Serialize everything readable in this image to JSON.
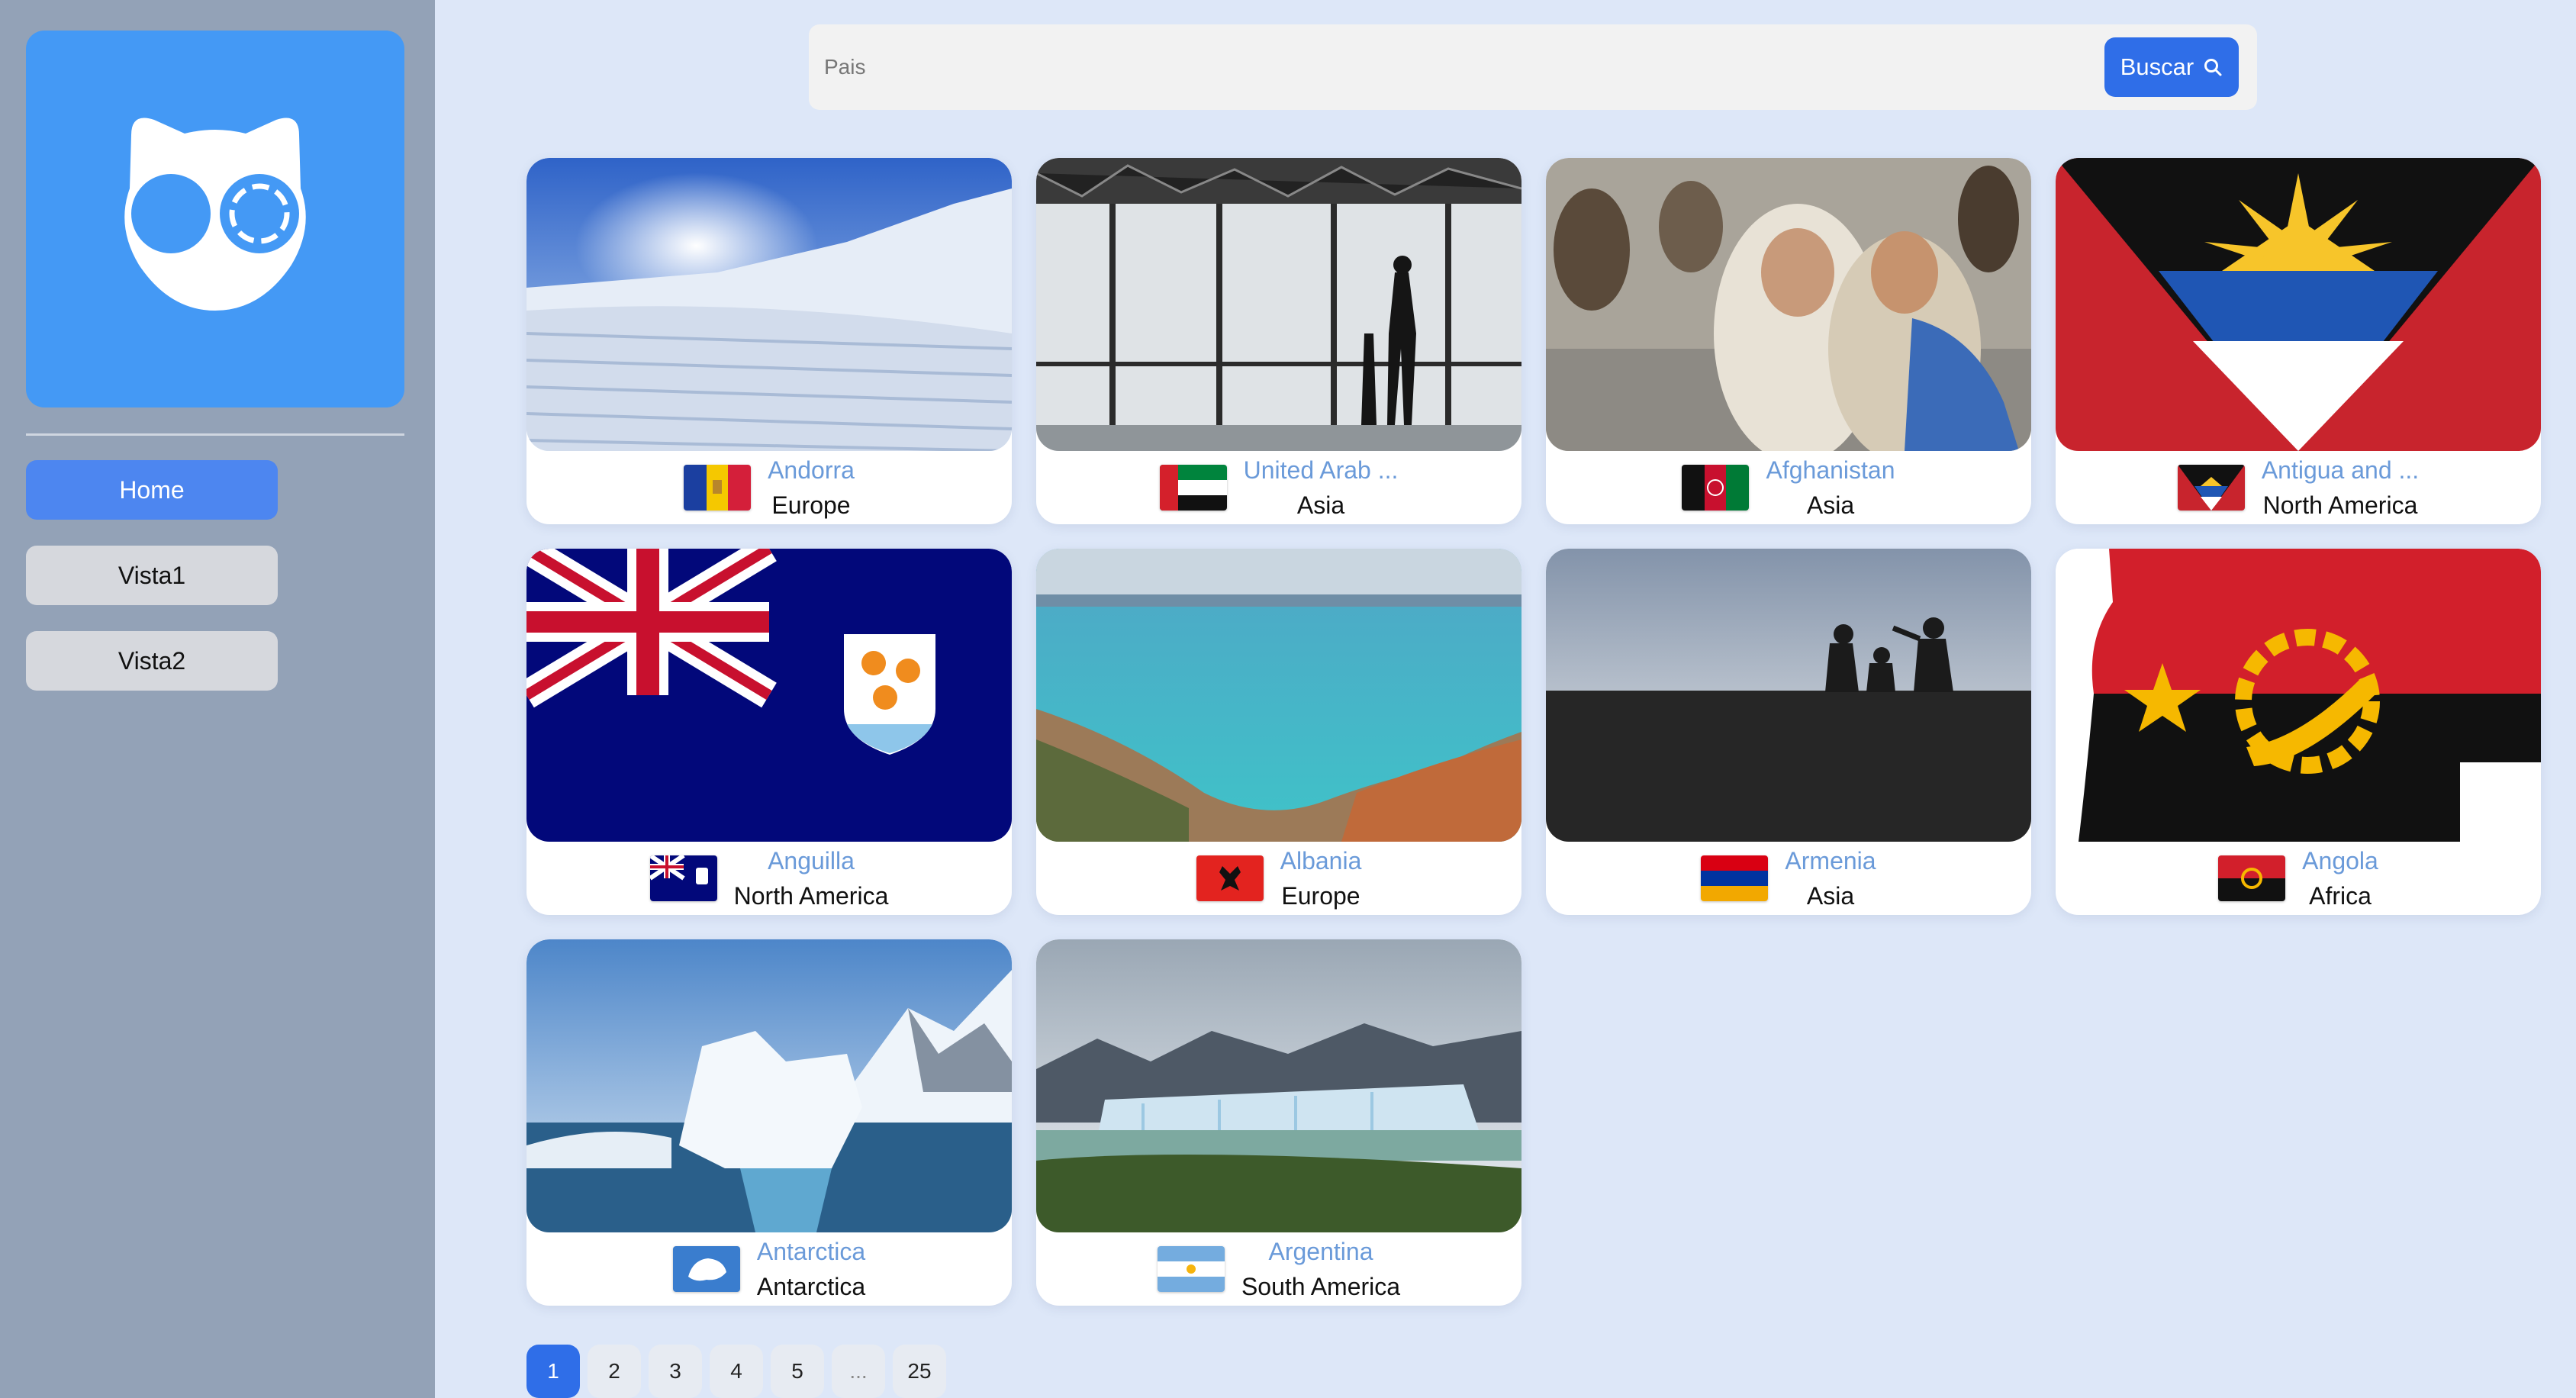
{
  "sidebar": {
    "nav": [
      {
        "label": "Home",
        "active": true
      },
      {
        "label": "Vista1",
        "active": false
      },
      {
        "label": "Vista2",
        "active": false
      }
    ]
  },
  "search": {
    "placeholder": "Pais",
    "button_label": "Buscar"
  },
  "countries": [
    {
      "name": "Andorra",
      "region": "Europe",
      "flag_icon": "andorra-flag-icon",
      "image": "ski-slope-snow-image"
    },
    {
      "name": "United Arab ...",
      "region": "Asia",
      "flag_icon": "uae-flag-icon",
      "image": "observation-deck-image"
    },
    {
      "name": "Afghanistan",
      "region": "Asia",
      "flag_icon": "afghanistan-flag-icon",
      "image": "children-photo-image"
    },
    {
      "name": "Antigua and ...",
      "region": "North America",
      "flag_icon": "antigua-flag-icon",
      "image": "antigua-flag-image"
    },
    {
      "name": "Anguilla",
      "region": "North America",
      "flag_icon": "anguilla-flag-icon",
      "image": "anguilla-flag-image"
    },
    {
      "name": "Albania",
      "region": "Europe",
      "flag_icon": "albania-flag-icon",
      "image": "coastline-image"
    },
    {
      "name": "Armenia",
      "region": "Asia",
      "flag_icon": "armenia-flag-icon",
      "image": "silhouette-image"
    },
    {
      "name": "Angola",
      "region": "Africa",
      "flag_icon": "angola-flag-icon",
      "image": "angola-map-flag-image"
    },
    {
      "name": "Antarctica",
      "region": "Antarctica",
      "flag_icon": "antarctica-flag-icon",
      "image": "iceberg-image"
    },
    {
      "name": "Argentina",
      "region": "South America",
      "flag_icon": "argentina-flag-icon",
      "image": "glacier-image"
    }
  ],
  "pagination": {
    "pages": [
      "1",
      "2",
      "3",
      "4",
      "5",
      "...",
      "25"
    ],
    "current": "1"
  },
  "colors": {
    "background": "#dde7f8",
    "sidebar": "#93a2b7",
    "logo_bg": "#4499f5",
    "accent": "#2f6ee8",
    "nav_active": "#4d86f0",
    "country_name": "#6a9ad9"
  }
}
